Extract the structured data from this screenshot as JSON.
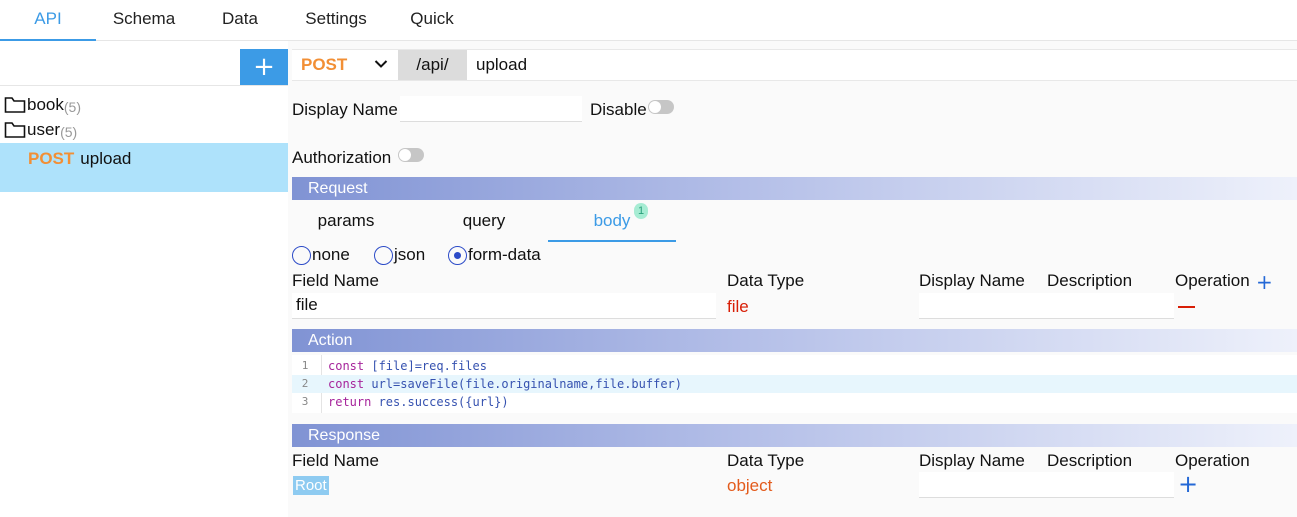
{
  "nav": {
    "tabs": [
      {
        "label": "API",
        "active": true
      },
      {
        "label": "Schema",
        "active": false
      },
      {
        "label": "Data",
        "active": false
      },
      {
        "label": "Settings",
        "active": false
      },
      {
        "label": "Quick",
        "active": false
      }
    ]
  },
  "sidebar": {
    "add_label": "+",
    "folders": [
      {
        "name": "book",
        "count": "(5)"
      },
      {
        "name": "user",
        "count": "(5)"
      }
    ],
    "selected_item": {
      "method": "POST",
      "name": "upload"
    }
  },
  "url_bar": {
    "method": "POST",
    "prefix": "/api/",
    "path": "upload"
  },
  "form": {
    "display_name_label": "Display Name",
    "display_name_value": "",
    "disable_label": "Disable",
    "disable_on": false,
    "authorization_label": "Authorization",
    "authorization_on": false
  },
  "request": {
    "title": "Request",
    "tabs": [
      {
        "label": "params",
        "active": false
      },
      {
        "label": "query",
        "active": false
      },
      {
        "label": "body",
        "active": true,
        "badge": "1"
      }
    ],
    "body_types": [
      {
        "label": "none",
        "selected": false
      },
      {
        "label": "json",
        "selected": false
      },
      {
        "label": "form-data",
        "selected": true
      }
    ],
    "columns": [
      "Field Name",
      "Data Type",
      "Display Name",
      "Description",
      "Operation"
    ],
    "add_icon": "+",
    "rows": [
      {
        "field_name": "file",
        "data_type": "file",
        "display_name": ""
      }
    ]
  },
  "action": {
    "title": "Action",
    "lines": [
      {
        "num": "1",
        "kw": "const",
        "rest": " [file]=req.files"
      },
      {
        "num": "2",
        "kw": "const",
        "rest": " url=saveFile(file.originalname,file.buffer)"
      },
      {
        "num": "3",
        "kw": "return",
        "rest": " res.success({url})"
      }
    ]
  },
  "response": {
    "title": "Response",
    "columns": [
      "Field Name",
      "Data Type",
      "Display Name",
      "Description",
      "Operation"
    ],
    "root_label": "Root",
    "root_type": "object",
    "add_icon": "+"
  },
  "colors": {
    "accent": "#3c9be6",
    "method": "#f28f35",
    "danger": "#d81e06",
    "selected_bg": "#aee2fb"
  }
}
